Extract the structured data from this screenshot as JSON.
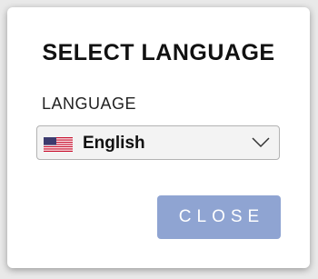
{
  "dialog": {
    "title": "SELECT LANGUAGE",
    "field_label": "LANGUAGE",
    "language_select": {
      "selected": "English",
      "flag_icon": "us-flag-icon"
    },
    "close_label": "CLOSE"
  },
  "colors": {
    "close_button": "#8fa4d2",
    "select_background": "#f3f3f3"
  }
}
